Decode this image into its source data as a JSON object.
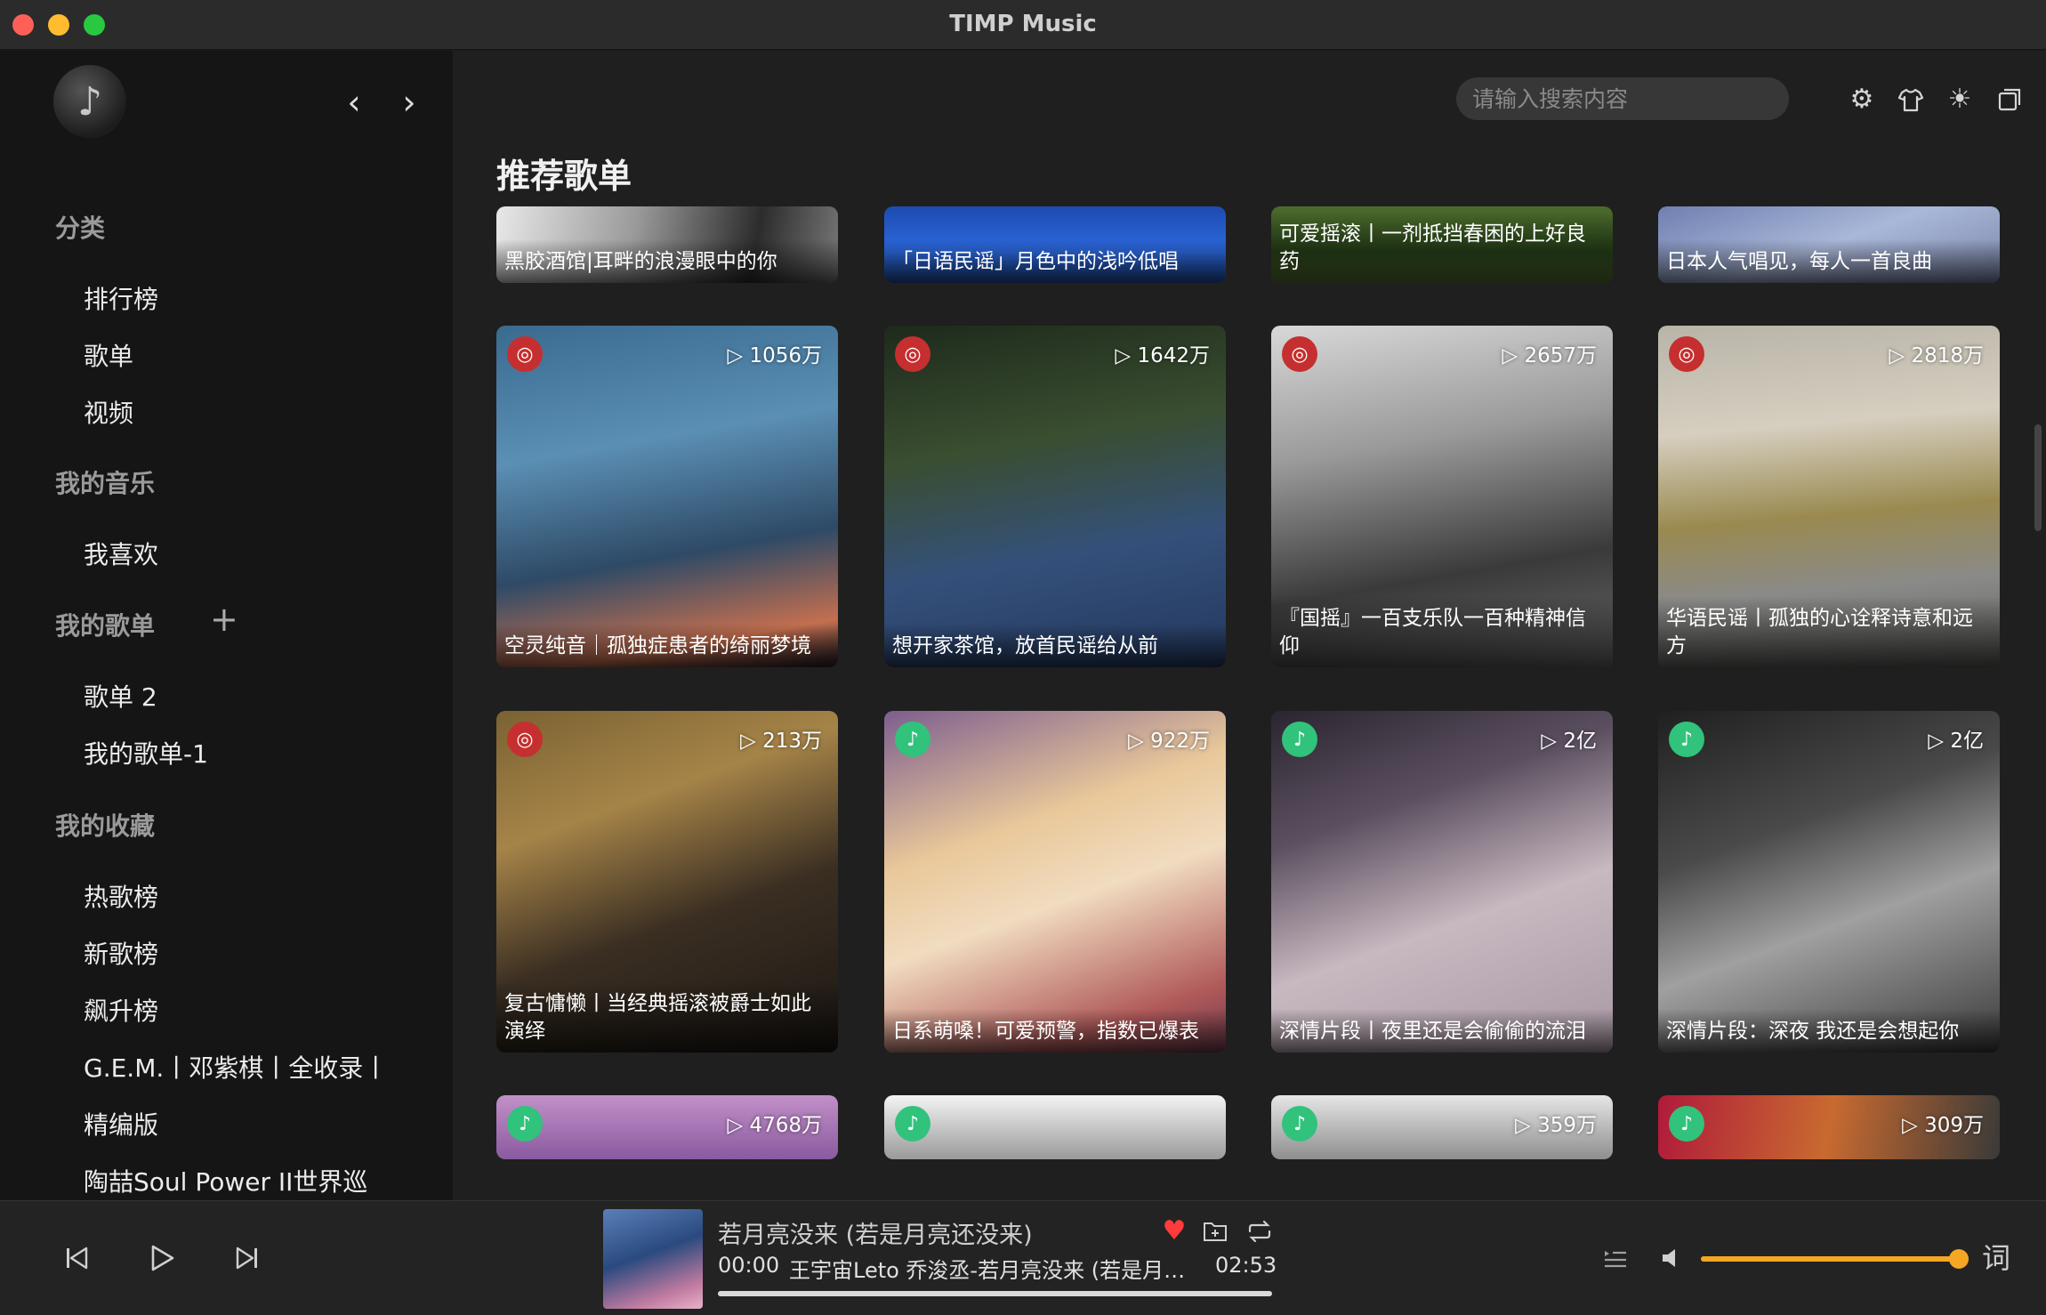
{
  "window": {
    "title": "TIMP Music"
  },
  "sidebar": {
    "sections": [
      {
        "label": "分类",
        "items": [
          "排行榜",
          "歌单",
          "视频"
        ]
      },
      {
        "label": "我的音乐",
        "items": [
          "我喜欢"
        ]
      },
      {
        "label": "我的歌单",
        "items": [
          "歌单 2",
          "我的歌单-1"
        ]
      },
      {
        "label": "我的收藏",
        "items": [
          "热歌榜",
          "新歌榜",
          "飙升榜",
          "G.E.M.丨邓紫棋丨全收录丨",
          "精编版",
          "陶喆Soul Power II世界巡"
        ]
      }
    ],
    "add_label": "+"
  },
  "header": {
    "search_placeholder": "请输入搜索内容"
  },
  "page": {
    "title": "推荐歌单"
  },
  "playlists": {
    "row0": [
      {
        "title": "黑胶酒馆|耳畔的浪漫眼中的你"
      },
      {
        "title": "「日语民谣」月色中的浅吟低唱"
      },
      {
        "title": "可爱摇滚丨一剂抵挡春困的上好良药"
      },
      {
        "title": "日本人气唱见，每人一首良曲"
      }
    ],
    "row1": [
      {
        "title": "空灵纯音｜孤独症患者的绮丽梦境",
        "plays": "▷ 1056万"
      },
      {
        "title": "想开家茶馆，放首民谣给从前",
        "plays": "▷ 1642万"
      },
      {
        "title": "『国摇』一百支乐队一百种精神信仰",
        "plays": "▷ 2657万"
      },
      {
        "title": "华语民谣丨孤独的心诠释诗意和远方",
        "plays": "▷ 2818万"
      }
    ],
    "row2": [
      {
        "title": "复古慵懒丨当经典摇滚被爵士如此演绎",
        "plays": "▷ 213万"
      },
      {
        "title": "日系萌嗓！可爱预警，指数已爆表",
        "plays": "▷ 922万"
      },
      {
        "title": "深情片段丨夜里还是会偷偷的流泪",
        "plays": "▷ 2亿"
      },
      {
        "title": "深情片段：深夜 我还是会想起你",
        "plays": "▷ 2亿"
      }
    ],
    "row3": [
      {
        "plays": "▷ 4768万"
      },
      {
        "plays": ""
      },
      {
        "plays": "▷ 359万"
      },
      {
        "plays": "▷ 309万"
      }
    ]
  },
  "player": {
    "song_title": "若月亮没来 (若是月亮还没来)",
    "current_time": "00:00",
    "artist_line": "王宇宙Leto 乔浚丞-若月亮没来 (若是月亮还没来)",
    "total_time": "02:53",
    "progress": 0.0,
    "volume": 1.0,
    "lyrics_label": "词"
  },
  "colors": {
    "accent": "#f5a623",
    "netease": "#c62f2f",
    "qqmusic": "#31c27c",
    "heart": "#ff3b3b"
  }
}
